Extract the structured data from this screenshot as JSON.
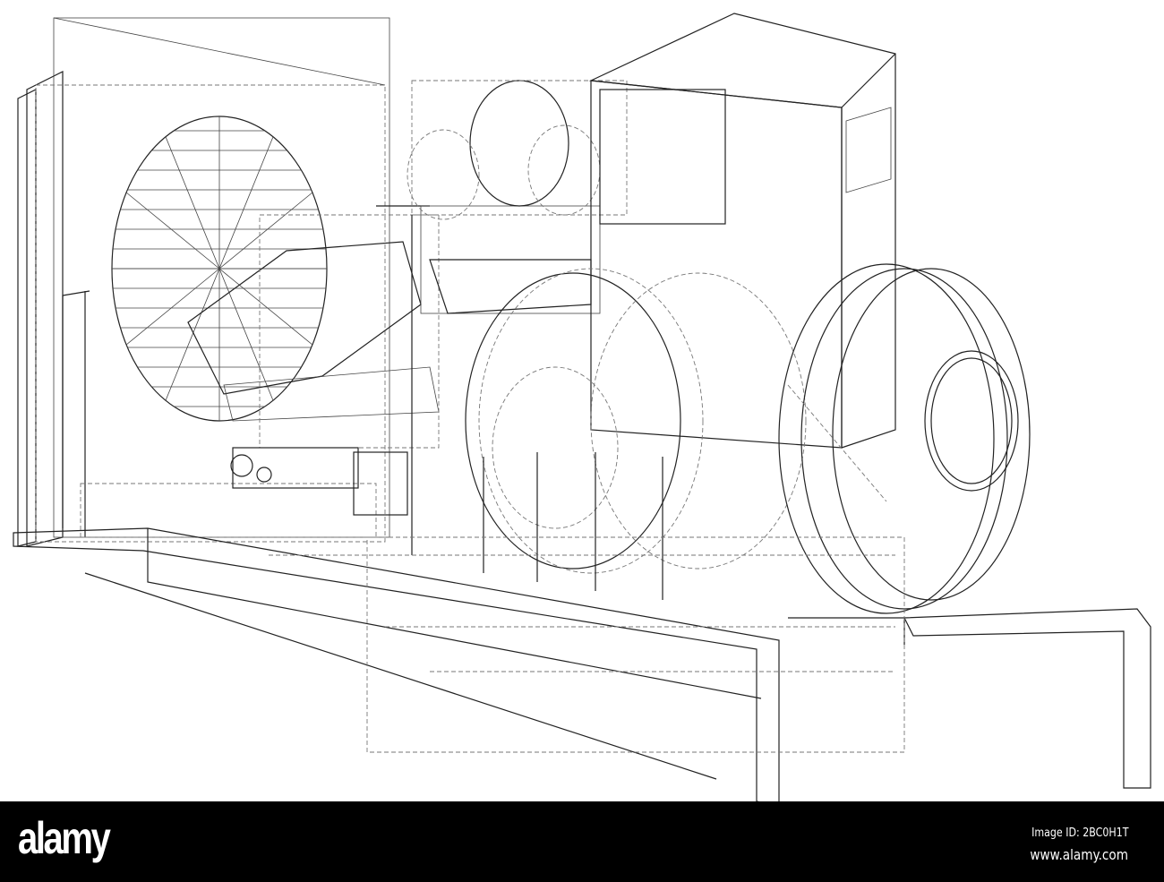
{
  "image": {
    "subject": "generator-wireframe"
  },
  "watermark": {
    "logo": "alamy",
    "image_id": "Image ID: 2BC0H1T",
    "url": "www.alamy.com"
  }
}
